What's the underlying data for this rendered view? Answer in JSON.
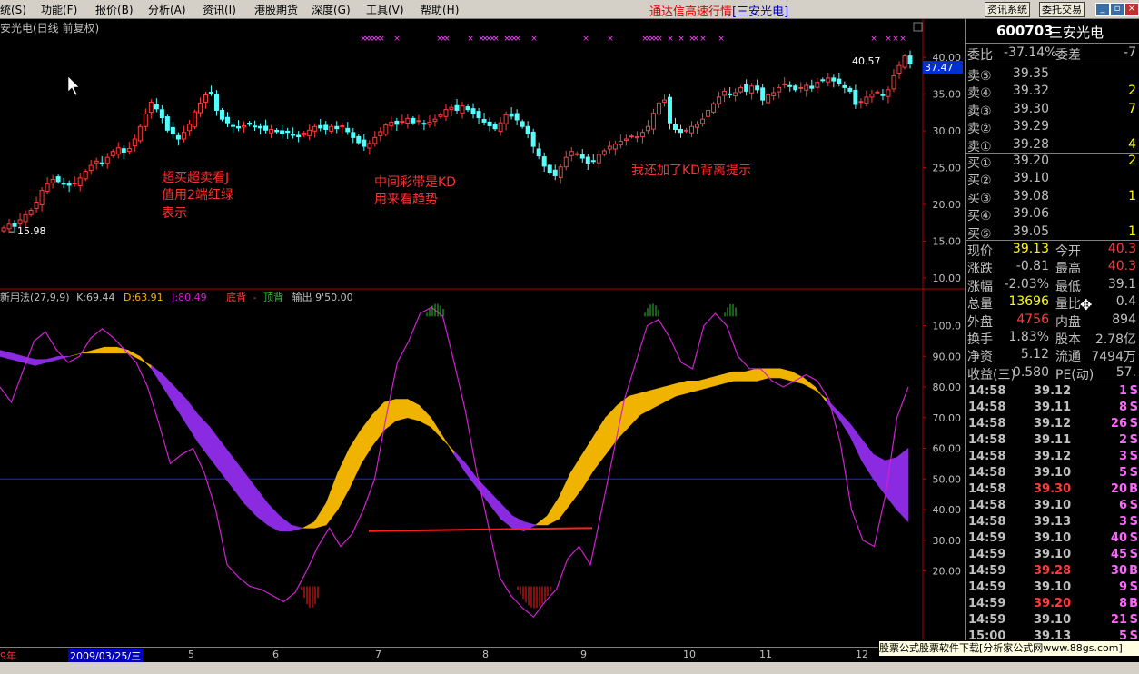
{
  "menu": {
    "items": [
      "统(S)",
      "功能(F)",
      "报价(B)",
      "分析(A)",
      "资讯(I)",
      "港股期货",
      "深度(G)",
      "工具(V)",
      "帮助(H)"
    ],
    "title_main": "通达信高速行情",
    "title_stock": "[三安光电]",
    "btn_news": "资讯系统",
    "btn_trade": "委托交易"
  },
  "chart_data": [
    {
      "type": "candlestick",
      "title": "安光电(日线 前复权)",
      "y_ticks": [
        "40.00",
        "35.00",
        "30.00",
        "25.00",
        "20.00",
        "15.00",
        "10.00"
      ],
      "ylim": [
        8.5,
        42.5
      ],
      "last_price_label": "37.47",
      "high_label": "40.57",
      "low_label": "15.98",
      "close": [
        16.8,
        17.3,
        17.0,
        17.9,
        18.6,
        19.2,
        20.3,
        21.9,
        22.8,
        23.4,
        23.1,
        22.8,
        22.6,
        22.9,
        23.6,
        24.5,
        25.3,
        25.9,
        25.6,
        26.4,
        27.2,
        27.7,
        27.1,
        27.6,
        28.9,
        30.6,
        32.3,
        33.9,
        33.0,
        31.8,
        30.1,
        29.6,
        28.9,
        29.8,
        30.9,
        32.6,
        33.8,
        34.9,
        35.2,
        32.8,
        31.6,
        31.1,
        30.7,
        30.4,
        30.7,
        30.9,
        30.6,
        30.4,
        30.1,
        30.2,
        29.9,
        29.6,
        29.8,
        29.4,
        29.2,
        29.7,
        30.1,
        30.6,
        30.4,
        30.2,
        30.6,
        30.3,
        30.7,
        29.9,
        29.1,
        28.4,
        27.9,
        28.3,
        29.1,
        29.9,
        30.8,
        31.2,
        30.9,
        31.3,
        31.7,
        31.1,
        31.4,
        31.0,
        31.2,
        31.6,
        32.2,
        32.9,
        33.2,
        32.8,
        33.4,
        32.9,
        32.3,
        31.8,
        31.2,
        30.7,
        30.3,
        31.1,
        32.2,
        32.0,
        31.5,
        30.6,
        29.6,
        27.9,
        26.6,
        25.2,
        24.3,
        23.9,
        25.1,
        26.4,
        27.2,
        26.9,
        26.3,
        25.6,
        25.9,
        26.8,
        27.3,
        27.9,
        28.2,
        28.6,
        28.9,
        29.3,
        29.2,
        29.8,
        30.6,
        32.4,
        33.8,
        34.2,
        31.1,
        30.2,
        29.8,
        30.1,
        30.6,
        30.9,
        31.6,
        32.8,
        33.7,
        34.6,
        35.4,
        34.9,
        35.2,
        35.9,
        35.4,
        36.1,
        35.6,
        34.2,
        34.9,
        35.2,
        35.9,
        36.4,
        36.1,
        35.6,
        35.9,
        36.2,
        35.8,
        36.6,
        36.9,
        37.2,
        36.8,
        36.5,
        35.9,
        35.4,
        33.6,
        34.0,
        34.6,
        35.0,
        35.3,
        34.8,
        35.6,
        37.5,
        38.9,
        40.2,
        39.1
      ]
    },
    {
      "type": "indicator",
      "title": "新用法(27,9,9)",
      "K": "K:69.44",
      "D": "D:63.91",
      "J": "J:80.49",
      "legend_bottom": "底背",
      "legend_top": "顶背",
      "legend_out": "输出 9'50.00",
      "y_ticks": [
        "100.0",
        "90.00",
        "80.00",
        "70.00",
        "60.00",
        "50.00",
        "40.00",
        "30.00",
        "20.00"
      ],
      "ylim": [
        -5.0,
        111.7
      ],
      "k": [
        90,
        89,
        88,
        87,
        88,
        89,
        90,
        91,
        92,
        93,
        93,
        92,
        90,
        86,
        80,
        74,
        68,
        62,
        57,
        52,
        47,
        42,
        38,
        35,
        33,
        33,
        34,
        36,
        42,
        52,
        60,
        66,
        71,
        75,
        76,
        76,
        74,
        70,
        64,
        58,
        52,
        47,
        42,
        37,
        34,
        33,
        35,
        38,
        44,
        52,
        58,
        64,
        70,
        74,
        77,
        78,
        79,
        80,
        81,
        82,
        82,
        83,
        84,
        85,
        85,
        86,
        86,
        86,
        85,
        83,
        80,
        75,
        70,
        64,
        56,
        50,
        45,
        40,
        36
      ],
      "d": [
        92,
        91,
        90,
        89,
        89,
        90,
        90,
        91,
        91,
        91,
        91,
        91,
        89,
        87,
        84,
        80,
        76,
        71,
        67,
        62,
        57,
        52,
        47,
        42,
        38,
        35,
        34,
        34,
        35,
        40,
        47,
        55,
        61,
        66,
        69,
        70,
        69,
        67,
        63,
        59,
        55,
        50,
        46,
        42,
        38,
        36,
        35,
        35,
        37,
        42,
        47,
        53,
        58,
        63,
        67,
        71,
        73,
        75,
        77,
        78,
        79,
        80,
        81,
        82,
        82,
        82,
        83,
        83,
        82,
        81,
        79,
        76,
        72,
        68,
        63,
        58,
        56,
        57,
        60
      ],
      "j": [
        80,
        75,
        85,
        95,
        98,
        92,
        88,
        90,
        96,
        99,
        96,
        92,
        88,
        80,
        68,
        55,
        58,
        60,
        52,
        40,
        22,
        18,
        15,
        14,
        12,
        10,
        13,
        20,
        28,
        34,
        28,
        32,
        40,
        50,
        70,
        88,
        95,
        104,
        106,
        103,
        88,
        72,
        52,
        35,
        18,
        12,
        8,
        5,
        10,
        14,
        24,
        28,
        22,
        40,
        58,
        76,
        88,
        100,
        102,
        96,
        88,
        86,
        100,
        104,
        100,
        90,
        86,
        86,
        82,
        80,
        82,
        84,
        82,
        76,
        62,
        40,
        30,
        28,
        45,
        70,
        80
      ]
    }
  ],
  "annotations": {
    "a1_l1": "超买超卖看J",
    "a1_l2": "值用2端红绿",
    "a1_l3": "表示",
    "a2_l1": "中间彩带是KD",
    "a2_l2": "用来看趋势",
    "a3_l1": "我还加了KD背离提示"
  },
  "xaxis": {
    "labels": [
      "9年",
      "2009/03/25/三",
      "5",
      "6",
      "7",
      "8",
      "9",
      "10",
      "11",
      "12"
    ]
  },
  "quote": {
    "code": "600703",
    "name": "三安光电",
    "wb_label": "委比",
    "wb_value": "-37.14%",
    "wc_label": "委差",
    "wc_value": "-7",
    "sells": [
      {
        "label": "卖⑤",
        "price": "39.35",
        "vol": ""
      },
      {
        "label": "卖④",
        "price": "39.32",
        "vol": "2"
      },
      {
        "label": "卖③",
        "price": "39.30",
        "vol": "7"
      },
      {
        "label": "卖②",
        "price": "39.29",
        "vol": ""
      },
      {
        "label": "卖①",
        "price": "39.28",
        "vol": "4"
      }
    ],
    "buys": [
      {
        "label": "买①",
        "price": "39.20",
        "vol": "2"
      },
      {
        "label": "买②",
        "price": "39.10",
        "vol": ""
      },
      {
        "label": "买③",
        "price": "39.08",
        "vol": "1"
      },
      {
        "label": "买④",
        "price": "39.06",
        "vol": ""
      },
      {
        "label": "买⑤",
        "price": "39.05",
        "vol": "1"
      }
    ],
    "stats": [
      {
        "l1": "现价",
        "v1": "39.13",
        "l2": "今开",
        "v2": "40.3",
        "c1": "#ffff00",
        "c2": "#ff3b3b"
      },
      {
        "l1": "涨跌",
        "v1": "-0.81",
        "l2": "最高",
        "v2": "40.3",
        "c1": "#c0c0c0",
        "c2": "#ff3b3b"
      },
      {
        "l1": "涨幅",
        "v1": "-2.03%",
        "l2": "最低",
        "v2": "39.1",
        "c1": "#c0c0c0",
        "c2": "#c0c0c0"
      },
      {
        "l1": "总量",
        "v1": "13696",
        "l2": "量比",
        "v2": "0.4",
        "c1": "#ffff00",
        "c2": "#c0c0c0"
      },
      {
        "l1": "外盘",
        "v1": "4756",
        "l2": "内盘",
        "v2": "894",
        "c1": "#ff3b3b",
        "c2": "#c0c0c0"
      },
      {
        "l1": "换手",
        "v1": "1.83%",
        "l2": "股本",
        "v2": "2.78亿",
        "c1": "#c0c0c0",
        "c2": "#c0c0c0"
      },
      {
        "l1": "净资",
        "v1": "5.12",
        "l2": "流通",
        "v2": "7494万",
        "c1": "#c0c0c0",
        "c2": "#c0c0c0"
      },
      {
        "l1": "收益(三)",
        "v1": "0.580",
        "l2": "PE(动)",
        "v2": "57.",
        "c1": "#c0c0c0",
        "c2": "#c0c0c0"
      }
    ],
    "ticks": [
      {
        "t": "14:58",
        "p": "39.12",
        "v": "1",
        "s": "S",
        "vc": "#ff66ff"
      },
      {
        "t": "14:58",
        "p": "39.11",
        "v": "8",
        "s": "S",
        "vc": "#ff66ff"
      },
      {
        "t": "14:58",
        "p": "39.12",
        "v": "26",
        "s": "S",
        "vc": "#ff66ff"
      },
      {
        "t": "14:58",
        "p": "39.11",
        "v": "2",
        "s": "S",
        "vc": "#ff66ff"
      },
      {
        "t": "14:58",
        "p": "39.12",
        "v": "3",
        "s": "S",
        "vc": "#ff66ff"
      },
      {
        "t": "14:58",
        "p": "39.10",
        "v": "5",
        "s": "S",
        "vc": "#ff66ff"
      },
      {
        "t": "14:58",
        "p": "39.30",
        "v": "20",
        "s": "B",
        "vc": "#ff66ff"
      },
      {
        "t": "14:58",
        "p": "39.10",
        "v": "6",
        "s": "S",
        "vc": "#ff66ff"
      },
      {
        "t": "14:58",
        "p": "39.13",
        "v": "3",
        "s": "S",
        "vc": "#ff66ff"
      },
      {
        "t": "14:59",
        "p": "39.10",
        "v": "40",
        "s": "S",
        "vc": "#ff66ff"
      },
      {
        "t": "14:59",
        "p": "39.10",
        "v": "45",
        "s": "S",
        "vc": "#ff66ff"
      },
      {
        "t": "14:59",
        "p": "39.28",
        "v": "30",
        "s": "B",
        "vc": "#ff66ff"
      },
      {
        "t": "14:59",
        "p": "39.10",
        "v": "9",
        "s": "S",
        "vc": "#ff66ff"
      },
      {
        "t": "14:59",
        "p": "39.20",
        "v": "8",
        "s": "B",
        "vc": "#ff66ff"
      },
      {
        "t": "14:59",
        "p": "39.10",
        "v": "21",
        "s": "S",
        "vc": "#ff66ff"
      },
      {
        "t": "15:00",
        "p": "39.13",
        "v": "5",
        "s": "S",
        "vc": "#ff66ff"
      }
    ]
  },
  "footer": "股票公式股票软件下载[分析家公式网www.88gs.com]",
  "colors": {
    "up": "#ff3b3b",
    "down": "#54ffff",
    "kd_up": "#f0b400",
    "kd_down": "#8a2be2",
    "j_line": "#d020d0",
    "axis": "#b00000",
    "mid_line": "#2020ff"
  }
}
